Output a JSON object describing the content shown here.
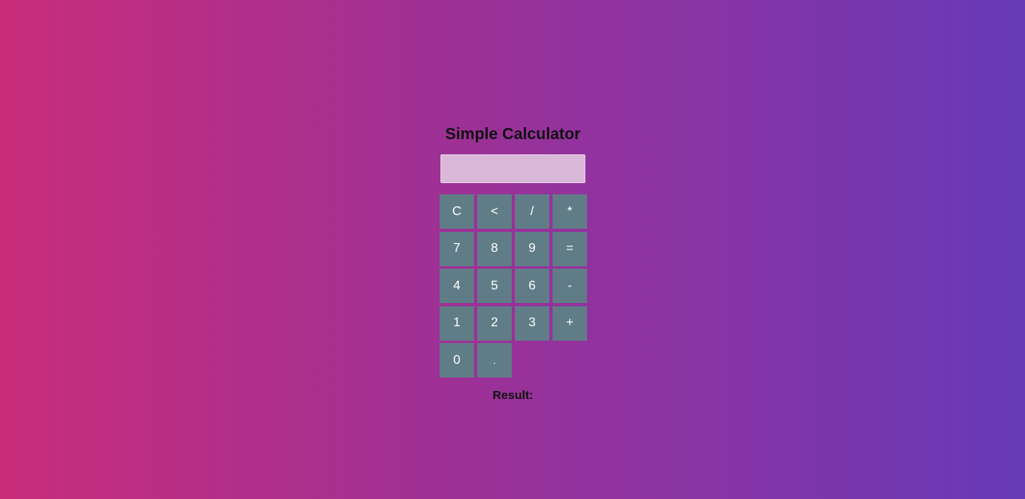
{
  "app": {
    "title": "Simple Calculator"
  },
  "display": {
    "value": "",
    "placeholder": ""
  },
  "keys": [
    {
      "label": "C",
      "name": "clear-button"
    },
    {
      "label": "<",
      "name": "backspace-button"
    },
    {
      "label": "/",
      "name": "divide-button"
    },
    {
      "label": "*",
      "name": "multiply-button"
    },
    {
      "label": "7",
      "name": "digit-7-button"
    },
    {
      "label": "8",
      "name": "digit-8-button"
    },
    {
      "label": "9",
      "name": "digit-9-button"
    },
    {
      "label": "=",
      "name": "equals-button"
    },
    {
      "label": "4",
      "name": "digit-4-button"
    },
    {
      "label": "5",
      "name": "digit-5-button"
    },
    {
      "label": "6",
      "name": "digit-6-button"
    },
    {
      "label": "-",
      "name": "subtract-button"
    },
    {
      "label": "1",
      "name": "digit-1-button"
    },
    {
      "label": "2",
      "name": "digit-2-button"
    },
    {
      "label": "3",
      "name": "digit-3-button"
    },
    {
      "label": "+",
      "name": "add-button"
    },
    {
      "label": "0",
      "name": "digit-0-button"
    },
    {
      "label": ".",
      "name": "decimal-button"
    }
  ],
  "result": {
    "label": "Result:",
    "value": ""
  },
  "colors": {
    "gradient_start": "#c92d7b",
    "gradient_end": "#673ab7",
    "key_background": "#607d87",
    "key_text": "#ffffff",
    "display_background": "#d9b8d9"
  }
}
